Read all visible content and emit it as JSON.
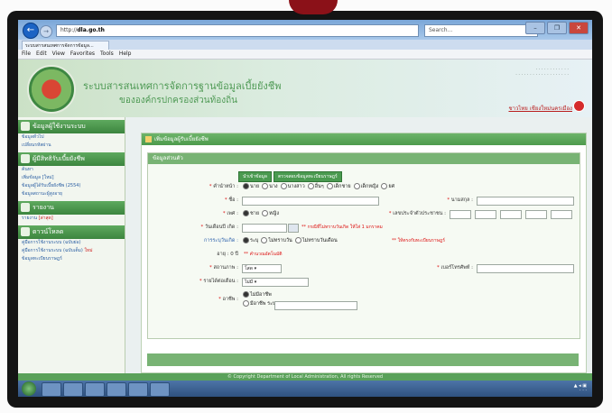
{
  "browser": {
    "address_prefix": "http://",
    "address_domain": "dla.go.th",
    "search_placeholder": "Search...",
    "tab_title": "ระบบสารสนเทศการจัดการข้อมูล...",
    "menu": [
      "File",
      "Edit",
      "View",
      "Favorites",
      "Tools",
      "Help"
    ],
    "window_controls": [
      "–",
      "❐",
      "✕"
    ]
  },
  "header": {
    "title": "ระบบสารสนเทศการจัดการฐานข้อมูลเบี้ยยังชีพ",
    "subtitle": "ขององค์กรปกครองส่วนท้องถิ่น",
    "user_link": "ชาวไทย เชียงใหม่นครเมือง"
  },
  "sidebar": {
    "sections": [
      {
        "title": "ข้อมูลผู้ใช้งานระบบ",
        "items": [
          {
            "label": "ข้อมูลทั่วไป",
            "tag": ""
          },
          {
            "label": "เปลี่ยนรหัสผ่าน",
            "tag": ""
          }
        ]
      },
      {
        "title": "ผู้มีสิทธิรับเบี้ยยังชีพ",
        "items": [
          {
            "label": "ค้นหา",
            "tag": ""
          },
          {
            "label": "เพิ่มข้อมูล [ใหม่]",
            "tag": ""
          },
          {
            "label": "ข้อมูลผู้ได้รับเบี้ยยังชีพ (2554)",
            "tag": ""
          },
          {
            "label": "ข้อมูลสถานะผู้สูงอายุ",
            "tag": ""
          }
        ]
      },
      {
        "title": "รายงาน",
        "items": [
          {
            "label": "รายงาน ",
            "tag": "[ล่าสุด]"
          }
        ]
      },
      {
        "title": "ดาวน์โหลด",
        "items": [
          {
            "label": "คู่มือการใช้งานระบบ (ฉบับย่อ)",
            "tag": ""
          },
          {
            "label": "คู่มือการใช้งานระบบ (ฉบับเต็ม) ",
            "tag": "ใหม่"
          },
          {
            "label": "ข้อมูลทะเบียนราษฎร์",
            "tag": ""
          }
        ]
      }
    ]
  },
  "main": {
    "heading": "เพิ่มข้อมูลผู้รับเบี้ยยังชีพ",
    "section_title": "ข้อมูลส่วนตัว",
    "buttons": [
      "นำเข้าข้อมูล",
      "ตรวจสอบข้อมูลทะเบียนราษฎร์"
    ],
    "title_label": "คำนำหน้า :",
    "title_options": [
      {
        "label": "นาย",
        "on": true
      },
      {
        "label": "นาง",
        "on": false
      },
      {
        "label": "นางสาว",
        "on": false
      },
      {
        "label": "อื่นๆ",
        "on": false
      },
      {
        "label": "เด็กชาย",
        "on": false
      },
      {
        "label": "เด็กหญิง",
        "on": false
      },
      {
        "label": "ยศ",
        "on": false
      }
    ],
    "name_label": "ชื่อ :",
    "surname_label": "นามสกุล :",
    "gender_label": "เพศ :",
    "gender_options": [
      {
        "label": "ชาย",
        "on": true
      },
      {
        "label": "หญิง",
        "on": false
      }
    ],
    "idcard_label": "เลขประจำตัวประชาชน :",
    "birth_label": "วันเดือนปี เกิด :",
    "birth_note": "** กรณีที่ไม่ทราบวันเกิด ให้ใส่ 1 มกราคม",
    "birthtype_label": "การระบุวันเกิด :",
    "birthtype_options": [
      {
        "label": "ระบุ",
        "on": true
      },
      {
        "label": "ไม่ทราบวัน",
        "on": false
      },
      {
        "label": "ไม่ทราบวันเดือน",
        "on": false
      }
    ],
    "birthtype_note": "** ให้ตรงกับทะเบียนราษฎร์",
    "age_label": "อายุ : 0 ปี",
    "age_note": "** คำนวณอัตโนมัติ",
    "status_label": "สถานภาพ :",
    "status_value": "โสด",
    "phone_label": "เบอร์โทรศัพท์ :",
    "income_label": "รายได้ต่อเดือน :",
    "income_value": "ไม่มี",
    "job_label": "อาชีพ :",
    "job_options": [
      {
        "label": "ไม่มีอาชีพ",
        "on": true
      },
      {
        "label": "มีอาชีพ ระบุ",
        "on": false
      }
    ]
  },
  "footer": "© Copyright Department of Local Administration, All rights Reserved"
}
